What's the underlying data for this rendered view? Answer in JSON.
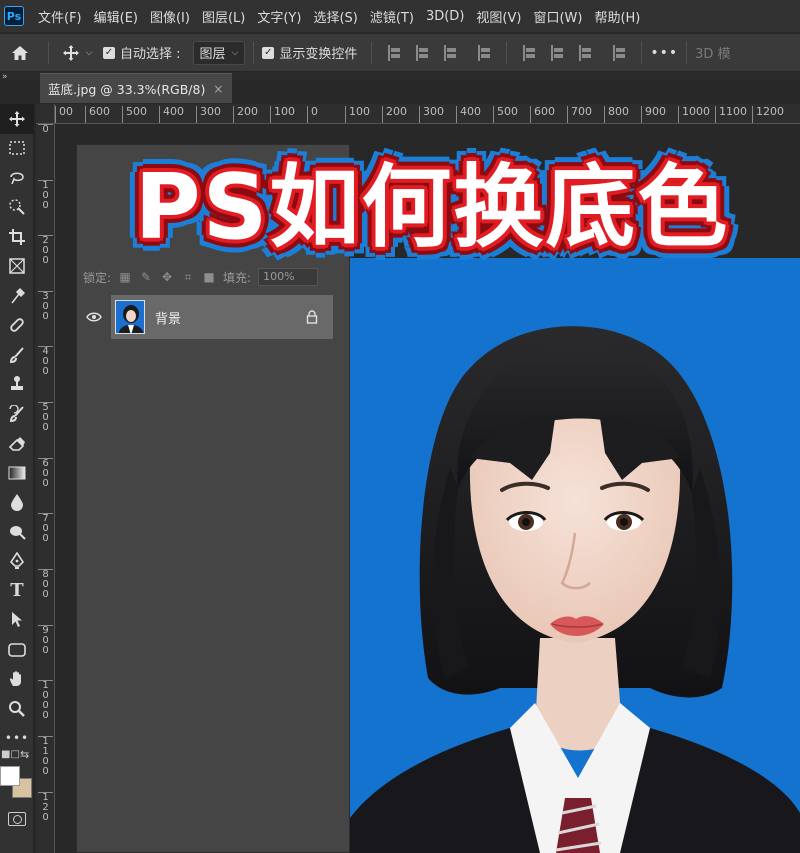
{
  "app": {
    "logo": "Ps"
  },
  "menu": [
    "文件(F)",
    "编辑(E)",
    "图像(I)",
    "图层(L)",
    "文字(Y)",
    "选择(S)",
    "滤镜(T)",
    "3D(D)",
    "视图(V)",
    "窗口(W)",
    "帮助(H)"
  ],
  "options": {
    "auto_select_label": "自动选择 :",
    "auto_select_value": "图层",
    "show_transform_label": "显示变换控件",
    "more_label": "•••",
    "mode_3d_label": "3D 模"
  },
  "tab": {
    "title": "蓝底.jpg @ 33.3%(RGB/8)",
    "close": "×"
  },
  "ruler_h": [
    "00",
    "600",
    "500",
    "400",
    "300",
    "200",
    "100",
    "0",
    "100",
    "200",
    "300",
    "400",
    "500",
    "600",
    "700",
    "800",
    "900",
    "1000",
    "1100",
    "1200"
  ],
  "ruler_v": [
    "0",
    "1 0 0",
    "2 0 0",
    "3 0 0",
    "4 0 0",
    "5 0 0",
    "6 0 0",
    "7 0 0",
    "8 0 0",
    "9 0 0",
    "1 0 0 0",
    "1 1 0 0",
    "1 2 0"
  ],
  "layers_panel": {
    "lock_label": "锁定:",
    "fill_label": "填充:",
    "fill_value": "100%",
    "layers": [
      {
        "name": "背景",
        "locked": true,
        "visible": true
      }
    ]
  },
  "toolbar": {
    "tools": [
      "move-icon",
      "marquee-icon",
      "lasso-icon",
      "quick-select-icon",
      "crop-icon",
      "frame-icon",
      "eyedropper-icon",
      "healing-icon",
      "brush-icon",
      "stamp-icon",
      "history-brush-icon",
      "eraser-icon",
      "gradient-icon",
      "blur-icon",
      "dodge-icon",
      "pen-icon",
      "type-icon",
      "path-select-icon",
      "shape-icon",
      "hand-icon",
      "zoom-icon",
      "more-tools-icon"
    ],
    "type_glyph": "T",
    "more_glyph": "•••",
    "foreground_color": "#ffffff",
    "background_color": "#d7c3a0"
  },
  "overlay": {
    "headline": "PS如何换底色"
  },
  "colors": {
    "photo_bg": "#1473ce",
    "headline_fill": "#ffffff",
    "headline_stroke": "#e11c22",
    "headline_outer": "#1b7fd8"
  }
}
